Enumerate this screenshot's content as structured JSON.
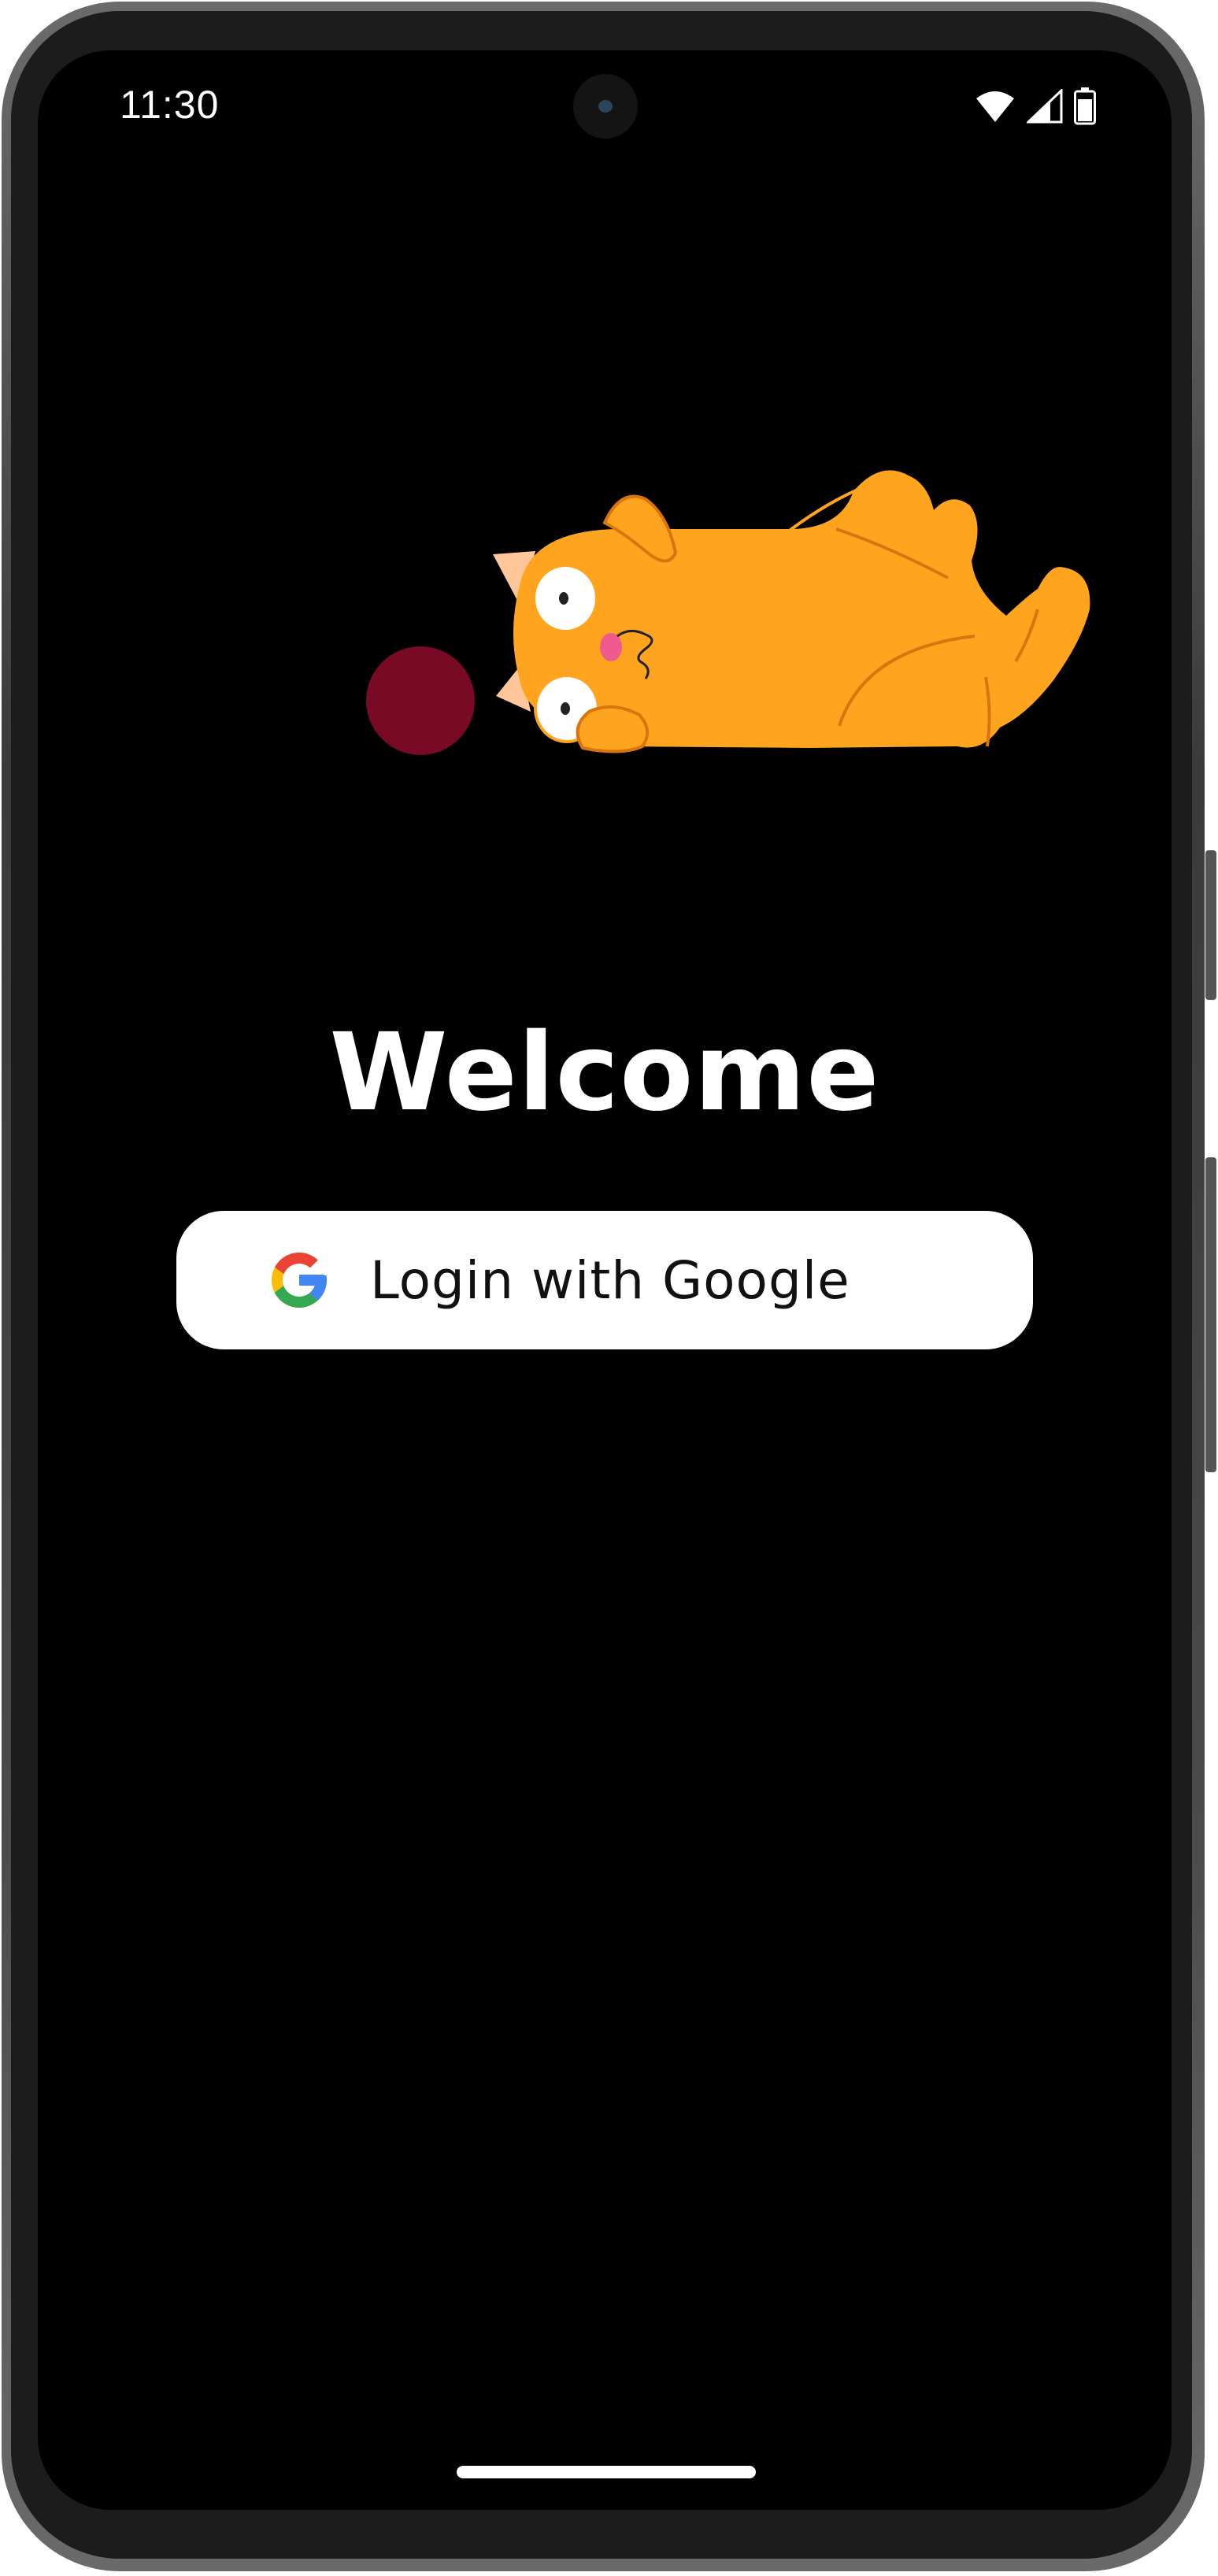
{
  "status_bar": {
    "time": "11:30",
    "icons": [
      "wifi-icon",
      "cellular-signal-icon",
      "battery-icon"
    ]
  },
  "illustration": {
    "subject": "cat-lying-with-yarn-ball",
    "colors": {
      "cat_body": "#FFA41F",
      "cat_stroke": "#D9750C",
      "ear_inner": "#FFC79A",
      "tongue": "#F05A8E",
      "yarn_ball": "#780A26"
    }
  },
  "welcome": {
    "title": "Welcome"
  },
  "login": {
    "label": "Login with Google",
    "icon": "google-logo-icon",
    "colors": {
      "blue": "#4285F4",
      "red": "#EA4335",
      "yellow": "#FBBC05",
      "green": "#34A853"
    }
  },
  "theme": {
    "background": "#000000",
    "text": "#FFFFFF",
    "button_background": "#FFFFFF",
    "button_text": "#111111"
  }
}
